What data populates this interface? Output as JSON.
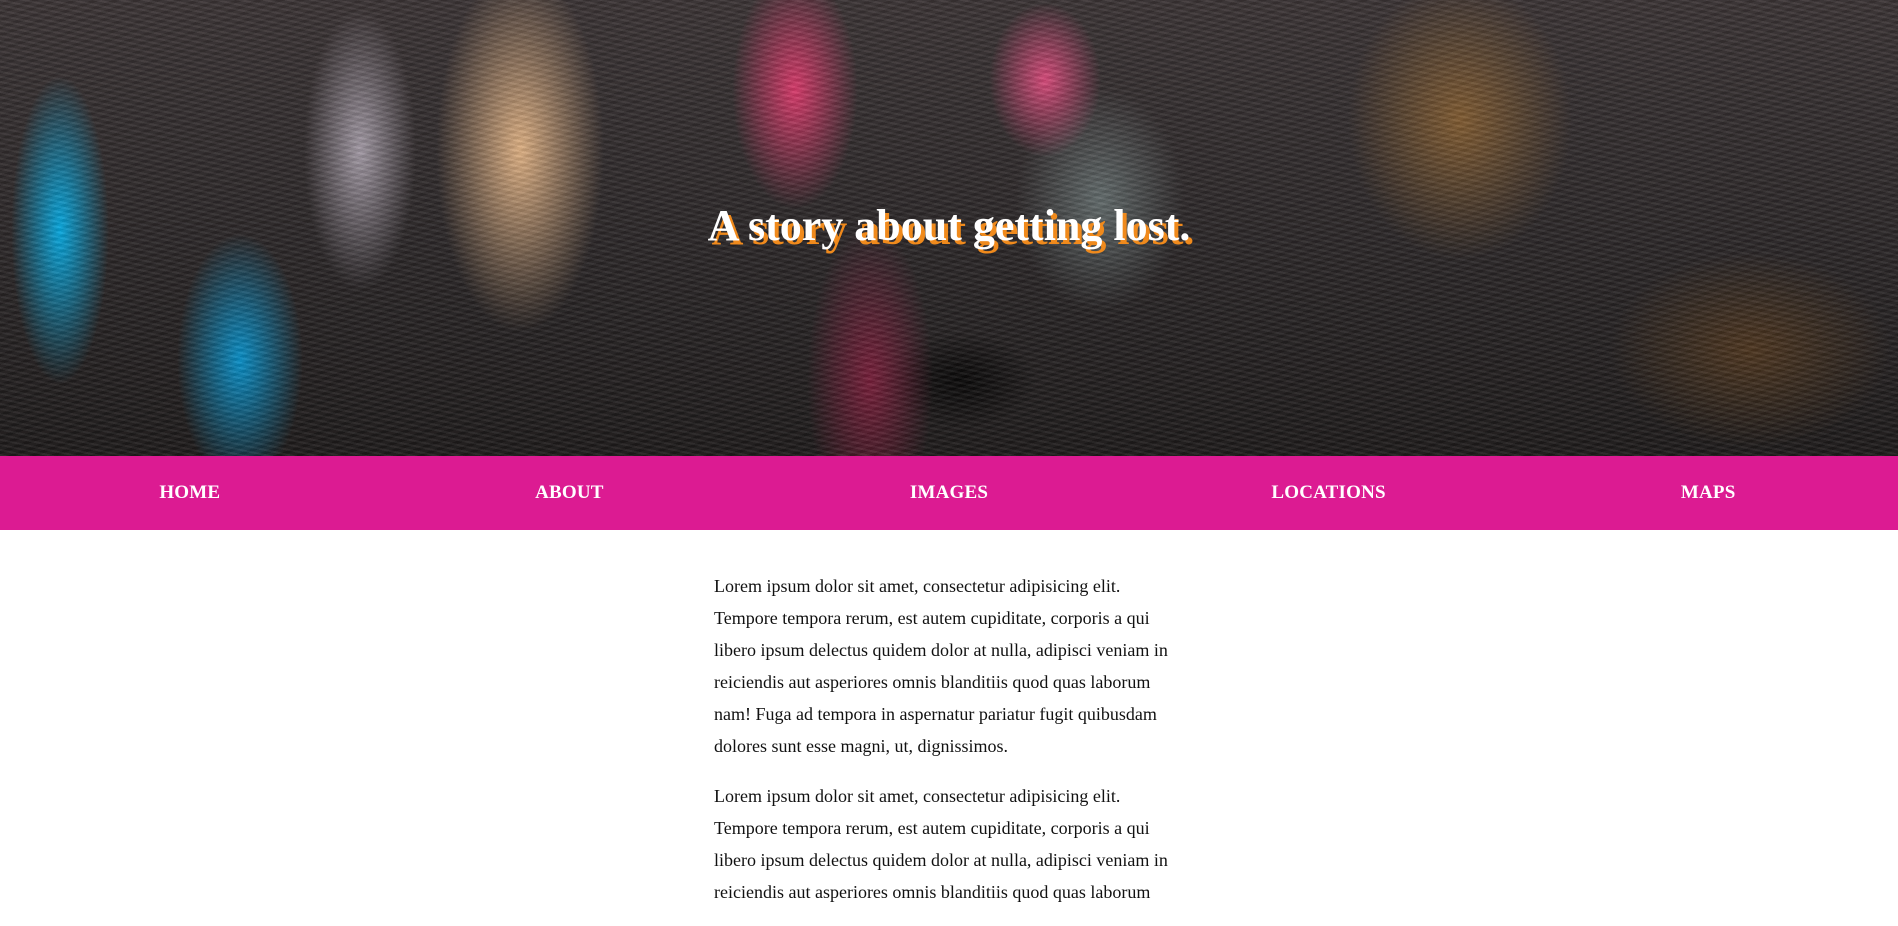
{
  "hero": {
    "title": "A story about getting lost."
  },
  "nav": {
    "items": [
      {
        "label": "HOME"
      },
      {
        "label": "ABOUT"
      },
      {
        "label": "IMAGES"
      },
      {
        "label": "LOCATIONS"
      },
      {
        "label": "MAPS"
      }
    ]
  },
  "content": {
    "paragraphs": [
      "Lorem ipsum dolor sit amet, consectetur adipisicing elit. Tempore tempora rerum, est autem cupiditate, corporis a qui libero ipsum delectus quidem dolor at nulla, adipisci veniam in reiciendis aut asperiores omnis blanditiis quod quas laborum nam! Fuga ad tempora in aspernatur pariatur fugit quibusdam dolores sunt esse magni, ut, dignissimos.",
      "Lorem ipsum dolor sit amet, consectetur adipisicing elit. Tempore tempora rerum, est autem cupiditate, corporis a qui libero ipsum delectus quidem dolor at nulla, adipisci veniam in reiciendis aut asperiores omnis blanditiis quod quas laborum"
    ]
  },
  "colors": {
    "nav_background": "#dc1b92",
    "title_shadow": "#f08a1c",
    "nav_text": "#ffffff"
  }
}
